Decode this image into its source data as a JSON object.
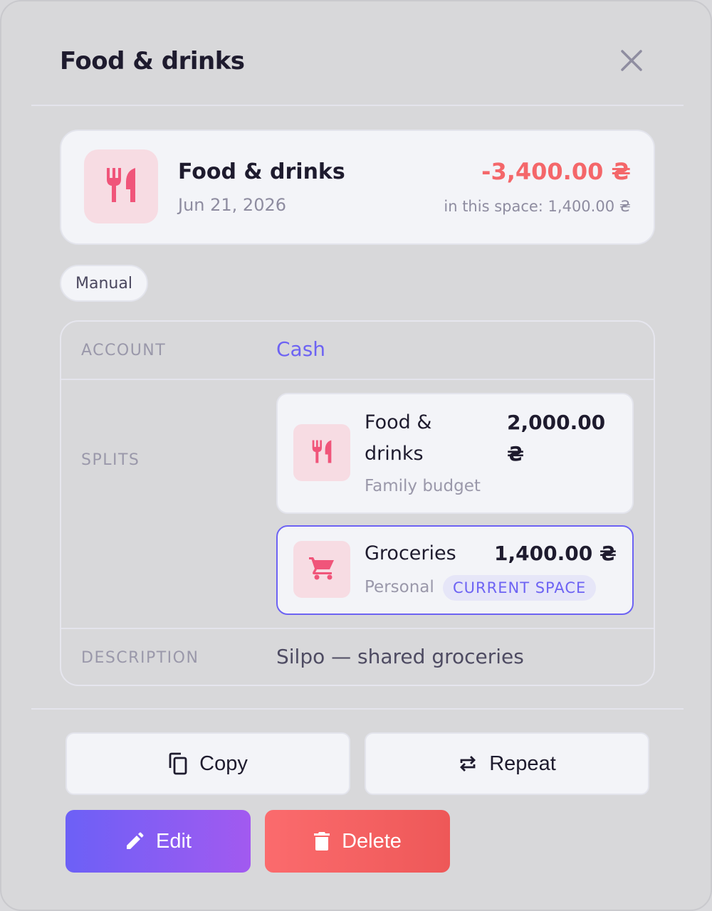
{
  "modal": {
    "title": "Food & drinks",
    "close_icon": "close-icon"
  },
  "summary": {
    "category_icon": "fork-knife-icon",
    "name": "Food & drinks",
    "date": "Jun 21, 2026",
    "amount": "-3,400.00 ₴",
    "in_space": "in this space: 1,400.00 ₴",
    "amount_color": "#f4676a"
  },
  "tag": "Manual",
  "details": {
    "account_label": "ACCOUNT",
    "account_value": "Cash",
    "splits_label": "SPLITS",
    "splits": [
      {
        "icon": "fork-knife-icon",
        "name_line1": "Food &",
        "name_line2": "drinks",
        "space": "Family budget",
        "amount_line1": "2,000.00",
        "amount_line2": "₴",
        "current": false
      },
      {
        "icon": "shopping-cart-icon",
        "name": "Groceries",
        "space": "Personal",
        "amount": "1,400.00 ₴",
        "badge": "CURRENT SPACE",
        "current": true
      }
    ],
    "description_label": "DESCRIPTION",
    "description_value": "Silpo — shared groceries"
  },
  "actions": {
    "copy_label": "Copy",
    "repeat_label": "Repeat",
    "edit_label": "Edit",
    "delete_label": "Delete"
  },
  "colors": {
    "accent": "#6d63f3",
    "danger": "#f4676a",
    "category_bg": "#f7dce3",
    "category_icon": "#f0557a"
  }
}
